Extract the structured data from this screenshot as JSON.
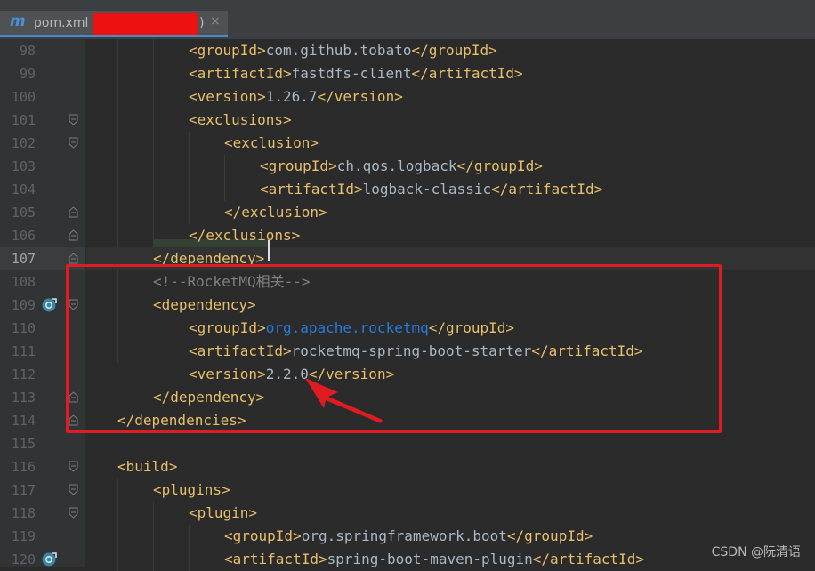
{
  "tab": {
    "icon": "m",
    "title": "pom.xml (",
    "title_end": ")",
    "close": "×"
  },
  "lines": [
    {
      "num": "98",
      "indent": 3,
      "parts": [
        [
          "tag",
          "<groupId>"
        ],
        [
          "txt",
          "com.github.tobato"
        ],
        [
          "tag",
          "</groupId>"
        ]
      ]
    },
    {
      "num": "99",
      "indent": 3,
      "parts": [
        [
          "tag",
          "<artifactId>"
        ],
        [
          "txt",
          "fastdfs-client"
        ],
        [
          "tag",
          "</artifactId>"
        ]
      ]
    },
    {
      "num": "100",
      "indent": 3,
      "parts": [
        [
          "tag",
          "<version>"
        ],
        [
          "txt",
          "1.26.7"
        ],
        [
          "tag",
          "</version>"
        ]
      ]
    },
    {
      "num": "101",
      "indent": 3,
      "fold": "open",
      "parts": [
        [
          "tag",
          "<exclusions>"
        ]
      ]
    },
    {
      "num": "102",
      "indent": 4,
      "fold": "open",
      "parts": [
        [
          "tag",
          "<exclusion>"
        ]
      ]
    },
    {
      "num": "103",
      "indent": 5,
      "parts": [
        [
          "tag",
          "<groupId>"
        ],
        [
          "txt",
          "ch.qos.logback"
        ],
        [
          "tag",
          "</groupId>"
        ]
      ]
    },
    {
      "num": "104",
      "indent": 5,
      "parts": [
        [
          "tag",
          "<artifactId>"
        ],
        [
          "txt",
          "logback-classic"
        ],
        [
          "tag",
          "</artifactId>"
        ]
      ]
    },
    {
      "num": "105",
      "indent": 4,
      "fold": "close",
      "parts": [
        [
          "tag",
          "</exclusion>"
        ]
      ]
    },
    {
      "num": "106",
      "indent": 3,
      "fold": "close",
      "parts": [
        [
          "tag",
          "</exclusions>"
        ]
      ]
    },
    {
      "num": "107",
      "indent": 2,
      "fold": "close",
      "current": true,
      "parts": [
        [
          "tag",
          "</dependency>"
        ]
      ]
    },
    {
      "num": "108",
      "indent": 2,
      "parts": [
        [
          "cmt",
          "<!--RocketMQ相关-->"
        ]
      ]
    },
    {
      "num": "109",
      "indent": 2,
      "fold": "open",
      "gicon": true,
      "parts": [
        [
          "tag",
          "<dependency>"
        ]
      ]
    },
    {
      "num": "110",
      "indent": 3,
      "parts": [
        [
          "tag",
          "<groupId>"
        ],
        [
          "lnk",
          "org.apache.rocketmq"
        ],
        [
          "tag",
          "</groupId>"
        ]
      ]
    },
    {
      "num": "111",
      "indent": 3,
      "parts": [
        [
          "tag",
          "<artifactId>"
        ],
        [
          "txt",
          "rocketmq-spring-boot-starter"
        ],
        [
          "tag",
          "</artifactId>"
        ]
      ]
    },
    {
      "num": "112",
      "indent": 3,
      "parts": [
        [
          "tag",
          "<version>"
        ],
        [
          "txt",
          "2.2.0"
        ],
        [
          "tag",
          "</version>"
        ]
      ]
    },
    {
      "num": "113",
      "indent": 2,
      "fold": "close",
      "parts": [
        [
          "tag",
          "</dependency>"
        ]
      ]
    },
    {
      "num": "114",
      "indent": 1,
      "fold": "close",
      "parts": [
        [
          "tag",
          "</dependencies>"
        ]
      ]
    },
    {
      "num": "115",
      "indent": 0,
      "parts": []
    },
    {
      "num": "116",
      "indent": 1,
      "fold": "open",
      "parts": [
        [
          "tag",
          "<build>"
        ]
      ]
    },
    {
      "num": "117",
      "indent": 2,
      "fold": "open",
      "parts": [
        [
          "tag",
          "<plugins>"
        ]
      ]
    },
    {
      "num": "118",
      "indent": 3,
      "fold": "open",
      "parts": [
        [
          "tag",
          "<plugin>"
        ]
      ]
    },
    {
      "num": "119",
      "indent": 4,
      "parts": [
        [
          "tag",
          "<groupId>"
        ],
        [
          "txt",
          "org.springframework.boot"
        ],
        [
          "tag",
          "</groupId>"
        ]
      ]
    },
    {
      "num": "120",
      "indent": 4,
      "gicon": true,
      "parts": [
        [
          "tag",
          "<artifactId>"
        ],
        [
          "txt",
          "spring-boot-maven-plugin"
        ],
        [
          "tag",
          "</artifactId>"
        ]
      ]
    }
  ],
  "watermark": "CSDN @阮清语",
  "colors": {
    "background": "#2b2b2b",
    "tag": "#e8bf6a",
    "text": "#a9b7c6",
    "comment": "#808080",
    "link": "#287bde",
    "annotation": "#e01b22"
  }
}
